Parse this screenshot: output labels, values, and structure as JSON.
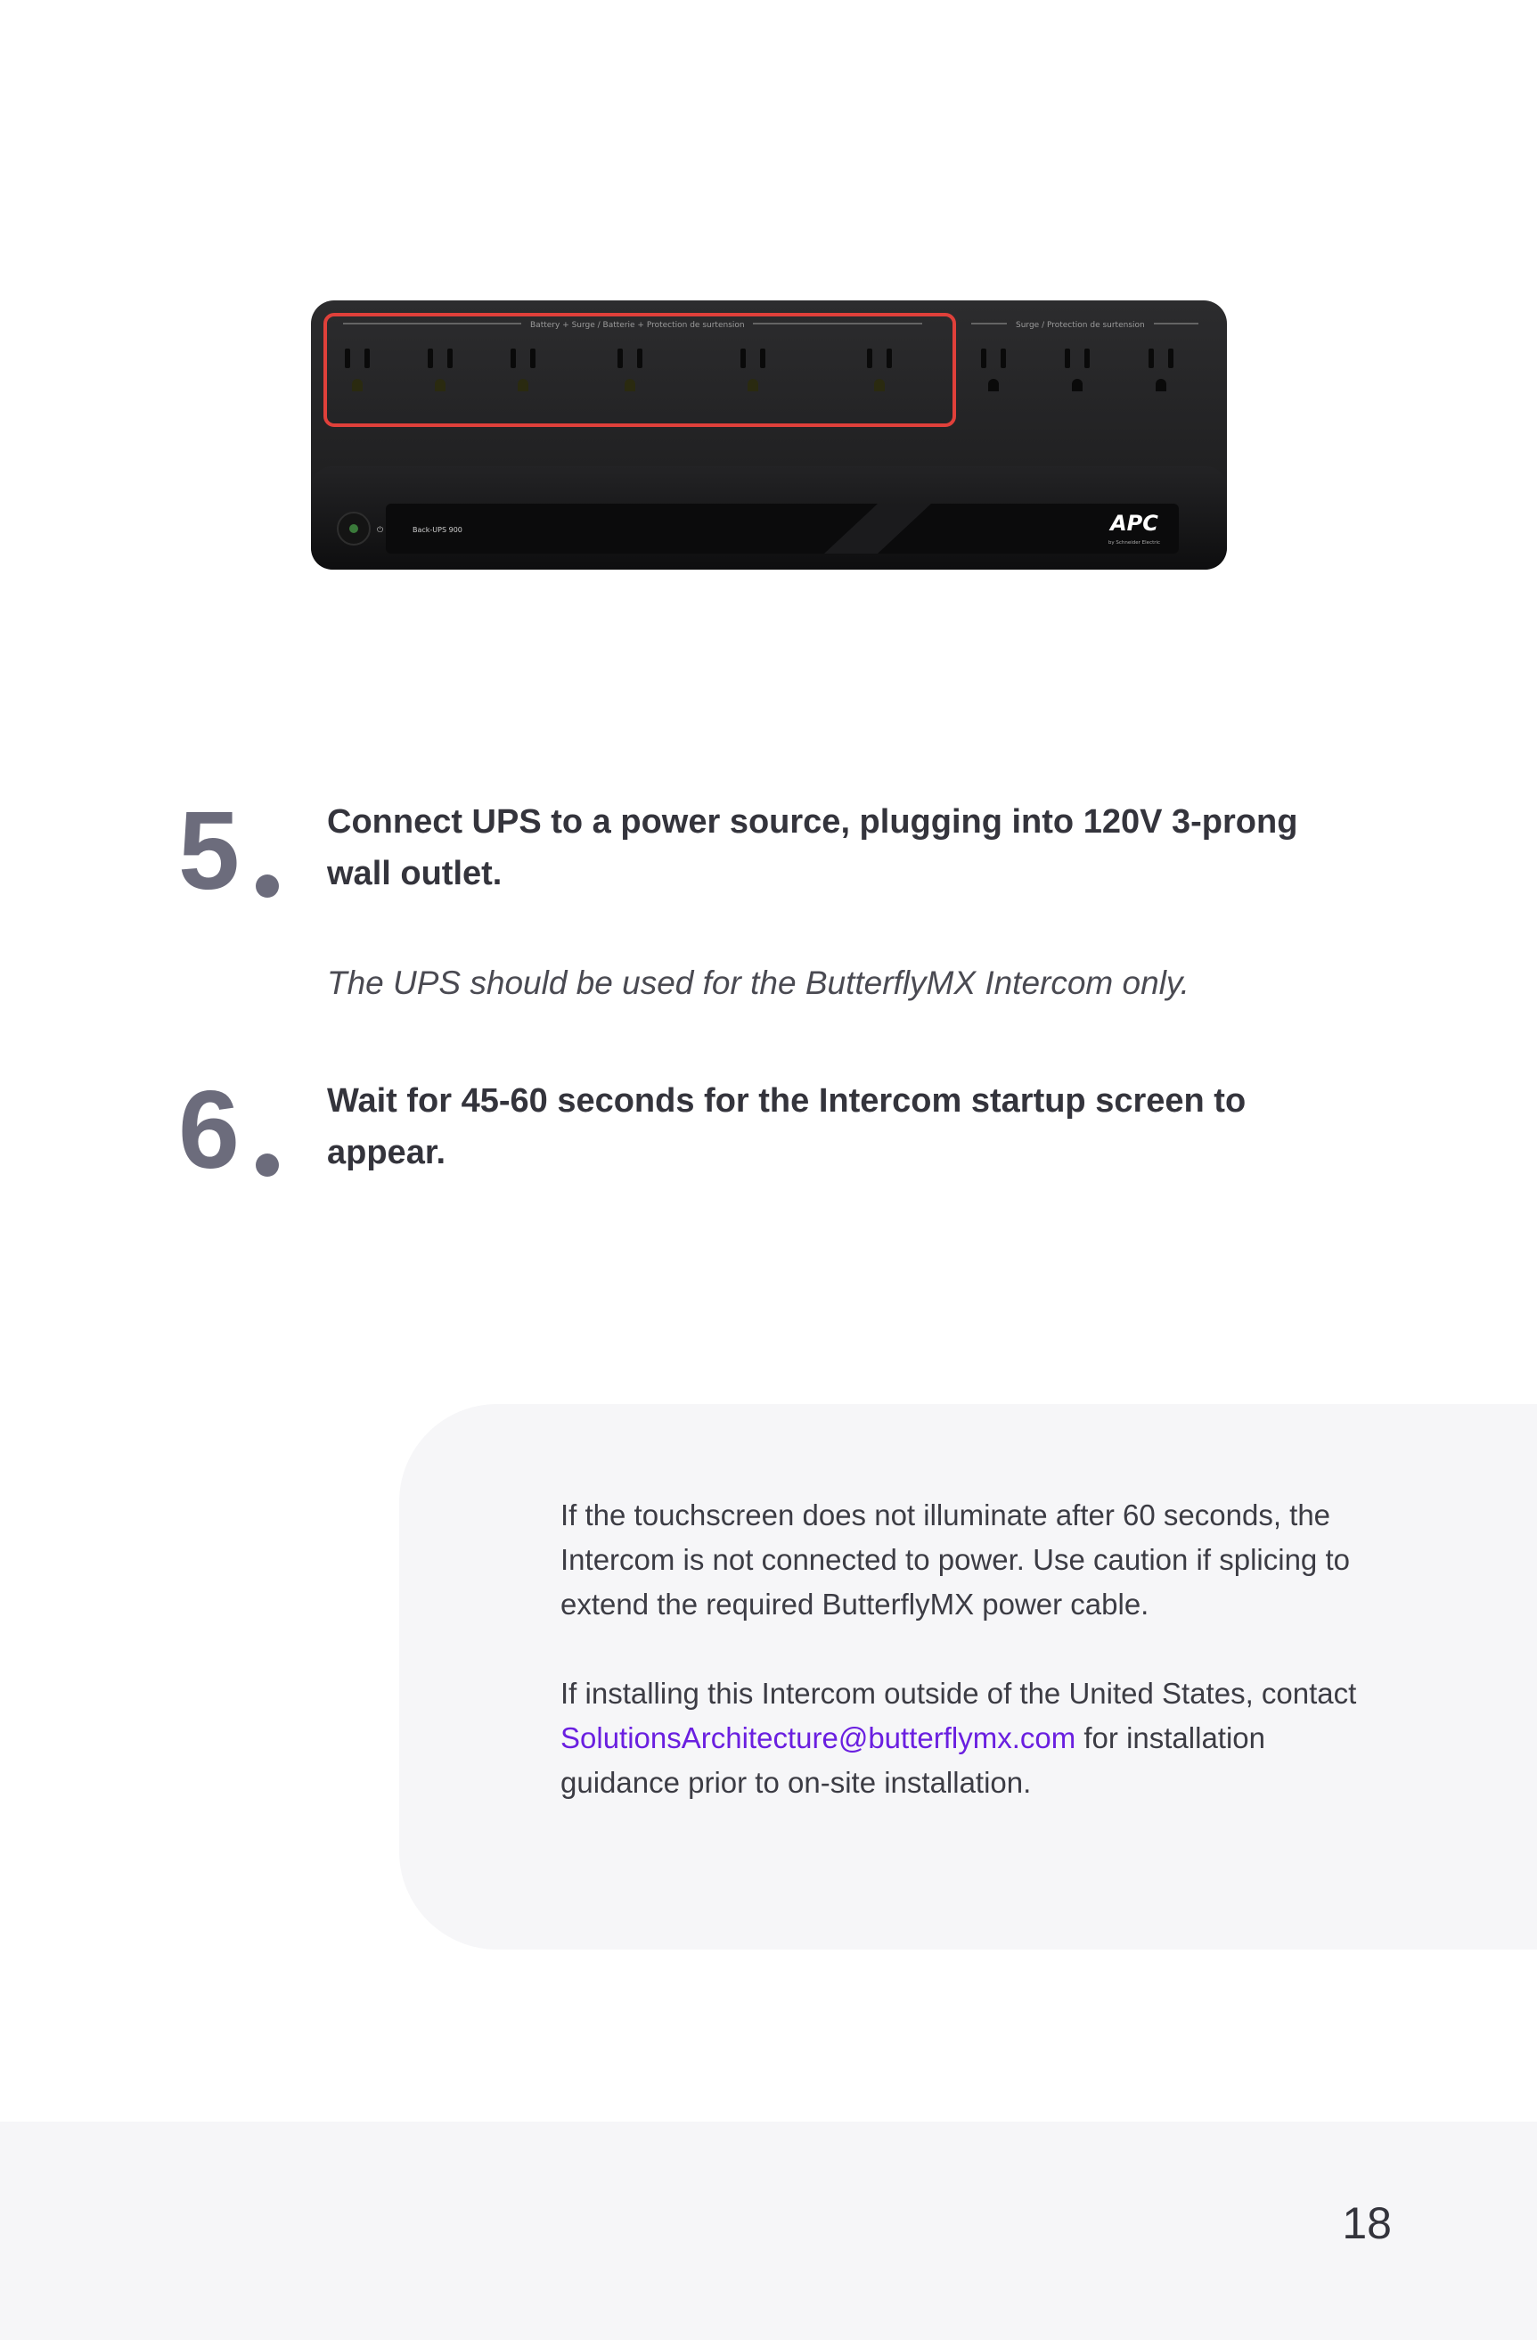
{
  "figure": {
    "label_left": "Battery + Surge / Batterie + Protection de surtension",
    "label_right": "Surge / Protection de surtension",
    "model": "Back-UPS 900",
    "brand": "APC",
    "brand_sub": "by Schneider Electric",
    "highlight_color": "#e0403a"
  },
  "steps": [
    {
      "number": "5",
      "text": "Connect UPS to a power source, plugging into 120V 3-prong wall outlet.",
      "note": "The UPS should be used for the ButterflyMX Intercom only."
    },
    {
      "number": "6",
      "text": "Wait for 45-60 seconds for the Intercom startup screen to appear."
    }
  ],
  "callout": {
    "p1": "If the touchscreen does not illuminate after 60 seconds, the Intercom is not connected to power. Use caution if splicing to extend the required ButterflyMX power cable.",
    "p2_before": "If installing this Intercom outside of the United States, contact",
    "p2_email": "SolutionsArchitecture@butterflymx.com",
    "p2_after": "for installation guidance prior to on-site installation."
  },
  "footer": {
    "page_number": "18"
  },
  "colors": {
    "accent": "#6a1fe0",
    "step_number": "#6c6c7c",
    "panel": "#f6f6f8"
  }
}
